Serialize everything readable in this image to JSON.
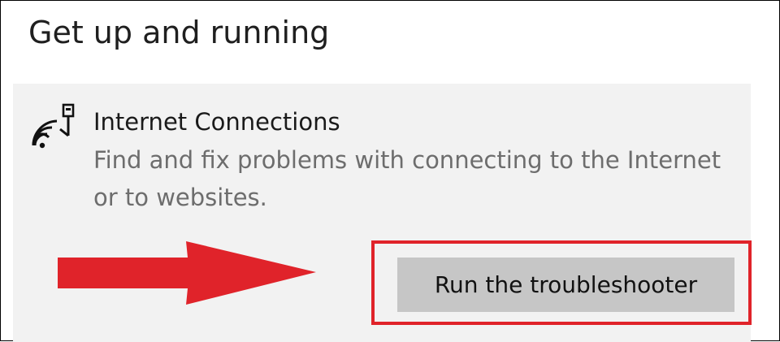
{
  "section": {
    "title": "Get up and running"
  },
  "troubleshooter": {
    "icon": "wifi-network-icon",
    "title": "Internet Connections",
    "description": "Find and fix problems with connecting to the Internet or to websites.",
    "button_label": "Run the troubleshooter"
  },
  "annotation": {
    "arrow_icon": "red-arrow-icon",
    "highlight_color": "#e0232a"
  },
  "colors": {
    "card_background": "#f2f2f2",
    "button_background": "#c6c6c6",
    "description_text": "#6d6d6d"
  }
}
